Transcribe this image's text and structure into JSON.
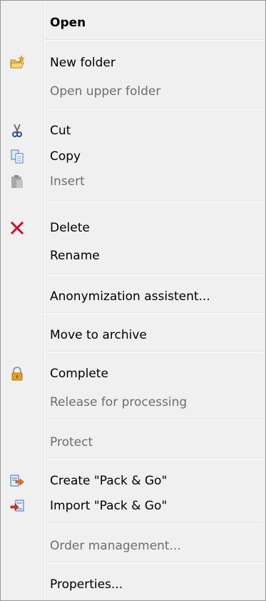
{
  "menu": {
    "items": {
      "open": {
        "label": "Open"
      },
      "new_folder": {
        "label": "New folder"
      },
      "open_upper_folder": {
        "label": "Open upper folder"
      },
      "cut": {
        "label": "Cut"
      },
      "copy": {
        "label": "Copy"
      },
      "insert": {
        "label": "Insert"
      },
      "delete": {
        "label": "Delete"
      },
      "rename": {
        "label": "Rename"
      },
      "anonymization": {
        "label": "Anonymization assistent..."
      },
      "move_to_archive": {
        "label": "Move to archive"
      },
      "complete": {
        "label": "Complete"
      },
      "release": {
        "label": "Release for processing"
      },
      "protect": {
        "label": "Protect"
      },
      "create_pack": {
        "label": "Create \"Pack & Go\""
      },
      "import_pack": {
        "label": "Import \"Pack & Go\""
      },
      "order_management": {
        "label": "Order management..."
      },
      "properties": {
        "label": "Properties..."
      }
    }
  },
  "icons": {
    "new_folder": "folder-star-icon",
    "cut": "scissors-icon",
    "copy": "copy-icon",
    "insert": "clipboard-icon",
    "delete": "red-x-icon",
    "complete": "lock-icon",
    "create_pack": "export-icon",
    "import_pack": "import-icon"
  },
  "colors": {
    "menu_background": "#f0f0f0",
    "disabled_text": "#6d6d6d",
    "delete_icon": "#c8102e",
    "lock_icon": "#e0a020"
  }
}
